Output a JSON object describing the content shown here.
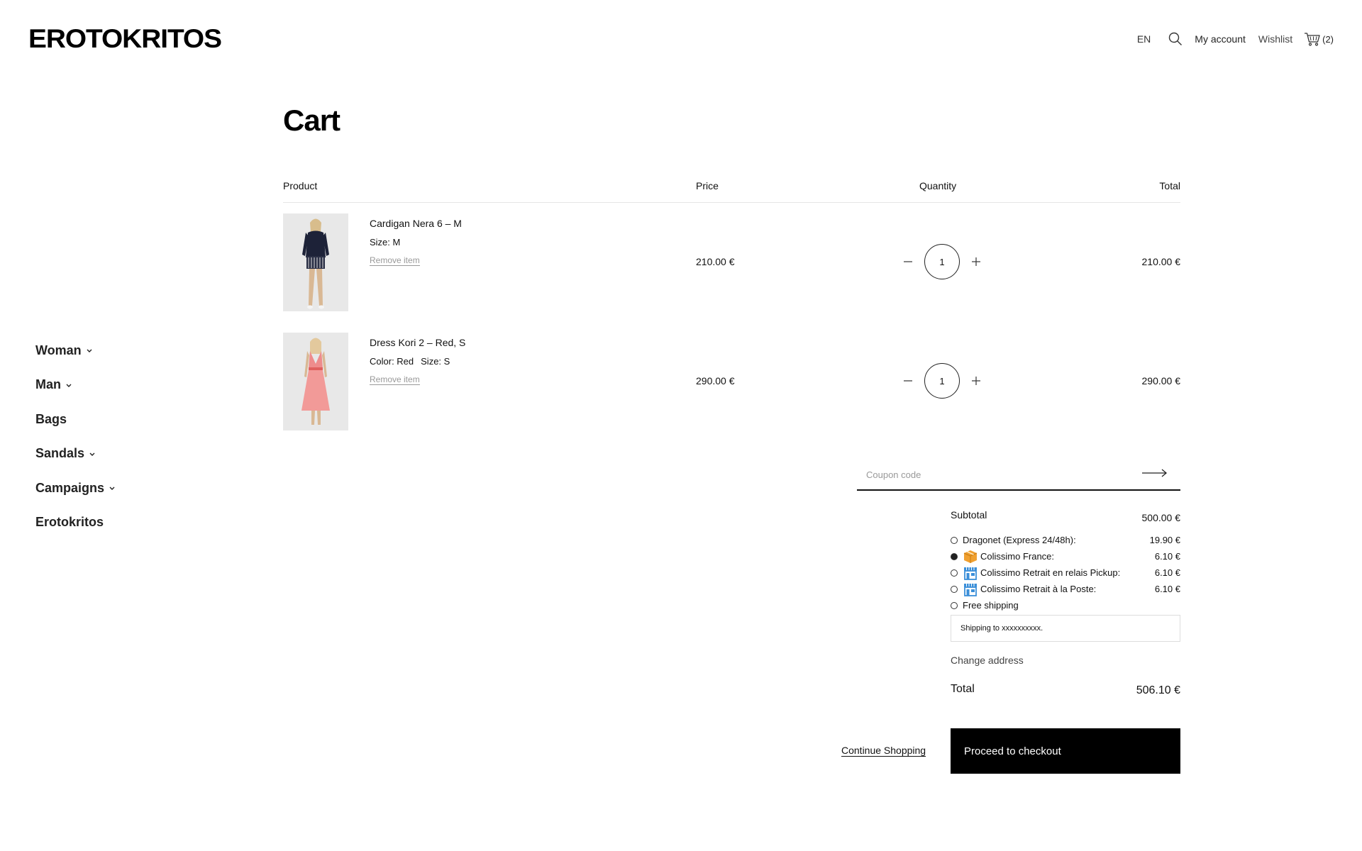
{
  "header": {
    "logo": "EROTOKRITOS",
    "lang": "EN",
    "my_account": "My account",
    "wishlist": "Wishlist",
    "cart_count": "(2)"
  },
  "sidenav": {
    "items": [
      {
        "label": "Woman",
        "has_dropdown": true
      },
      {
        "label": "Man",
        "has_dropdown": true
      },
      {
        "label": "Bags",
        "has_dropdown": false
      },
      {
        "label": "Sandals",
        "has_dropdown": true
      },
      {
        "label": "Campaigns",
        "has_dropdown": true
      },
      {
        "label": "Erotokritos",
        "has_dropdown": false
      }
    ]
  },
  "page": {
    "title": "Cart"
  },
  "table": {
    "headers": {
      "product": "Product",
      "price": "Price",
      "quantity": "Quantity",
      "total": "Total"
    },
    "rows": [
      {
        "name": "Cardigan Nera 6 – M",
        "attrs": [
          "Size: M"
        ],
        "remove": "Remove item",
        "price": "210.00 €",
        "qty": "1",
        "total": "210.00 €"
      },
      {
        "name": "Dress Kori 2 – Red, S",
        "attrs": [
          "Color: Red",
          "Size: S"
        ],
        "remove": "Remove item",
        "price": "290.00 €",
        "qty": "1",
        "total": "290.00 €"
      }
    ]
  },
  "coupon": {
    "placeholder": "Coupon code"
  },
  "totals": {
    "subtotal_label": "Subtotal",
    "subtotal_value": "500.00 €",
    "shipping": [
      {
        "label": "Dragonet (Express 24/48h):",
        "value": "19.90 €",
        "selected": false,
        "icon": ""
      },
      {
        "label": "Colissimo France:",
        "value": "6.10 €",
        "selected": true,
        "icon": "package-icon"
      },
      {
        "label": "Colissimo Retrait en relais Pickup:",
        "value": "6.10 €",
        "selected": false,
        "icon": "store-icon"
      },
      {
        "label": "Colissimo Retrait à la Poste:",
        "value": "6.10 €",
        "selected": false,
        "icon": "store-icon"
      },
      {
        "label": "Free shipping",
        "value": "",
        "selected": false,
        "icon": ""
      }
    ],
    "shipping_to": "Shipping to xxxxxxxxxx.",
    "change_address": "Change address",
    "total_label": "Total",
    "total_value": "506.10 €"
  },
  "actions": {
    "continue": "Continue Shopping",
    "checkout": "Proceed to checkout"
  },
  "colors": {
    "accent": "#000000",
    "package_icon": "#f0a030",
    "store_icon": "#3b8fd9"
  }
}
